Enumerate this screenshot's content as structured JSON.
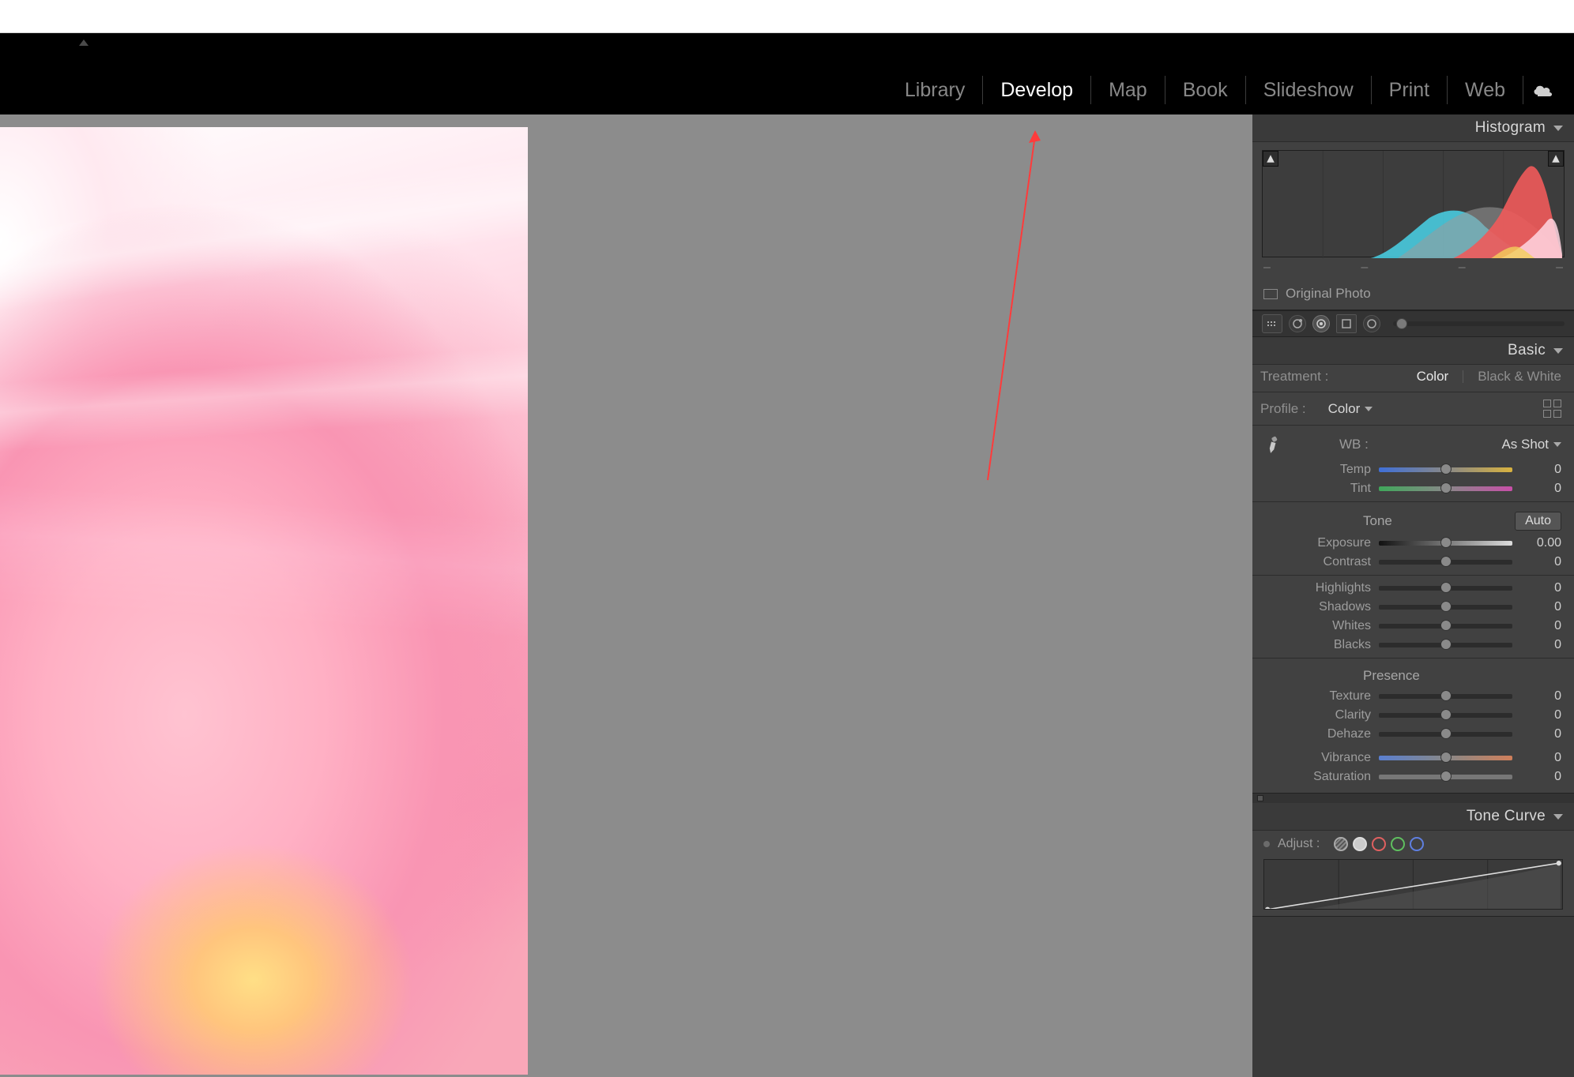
{
  "modules": {
    "library": "Library",
    "develop": "Develop",
    "map": "Map",
    "book": "Book",
    "slideshow": "Slideshow",
    "print": "Print",
    "web": "Web"
  },
  "histogram": {
    "title": "Histogram",
    "info1": "–",
    "info2": "–",
    "info3": "–",
    "info4": "–",
    "original_label": "Original Photo"
  },
  "basic": {
    "title": "Basic",
    "treatment_label": "Treatment :",
    "treatment_color": "Color",
    "treatment_bw": "Black & White",
    "profile_label": "Profile :",
    "profile_value": "Color",
    "wb_label": "WB :",
    "wb_value": "As Shot",
    "tone_label": "Tone",
    "auto_label": "Auto",
    "presence_label": "Presence",
    "sliders": {
      "temp": {
        "label": "Temp",
        "value": "0"
      },
      "tint": {
        "label": "Tint",
        "value": "0"
      },
      "exposure": {
        "label": "Exposure",
        "value": "0.00"
      },
      "contrast": {
        "label": "Contrast",
        "value": "0"
      },
      "highlights": {
        "label": "Highlights",
        "value": "0"
      },
      "shadows": {
        "label": "Shadows",
        "value": "0"
      },
      "whites": {
        "label": "Whites",
        "value": "0"
      },
      "blacks": {
        "label": "Blacks",
        "value": "0"
      },
      "texture": {
        "label": "Texture",
        "value": "0"
      },
      "clarity": {
        "label": "Clarity",
        "value": "0"
      },
      "dehaze": {
        "label": "Dehaze",
        "value": "0"
      },
      "vibrance": {
        "label": "Vibrance",
        "value": "0"
      },
      "saturation": {
        "label": "Saturation",
        "value": "0"
      }
    }
  },
  "tone_curve": {
    "title": "Tone Curve",
    "adjust_label": "Adjust :"
  },
  "colors": {
    "bg_canvas": "#8c8c8c",
    "panel": "#414141",
    "header_black": "#000000"
  },
  "icons": {
    "cloud": "cloud-icon",
    "eyedropper": "eyedropper-icon",
    "clip_triangle": "clipping-warning-icon"
  }
}
